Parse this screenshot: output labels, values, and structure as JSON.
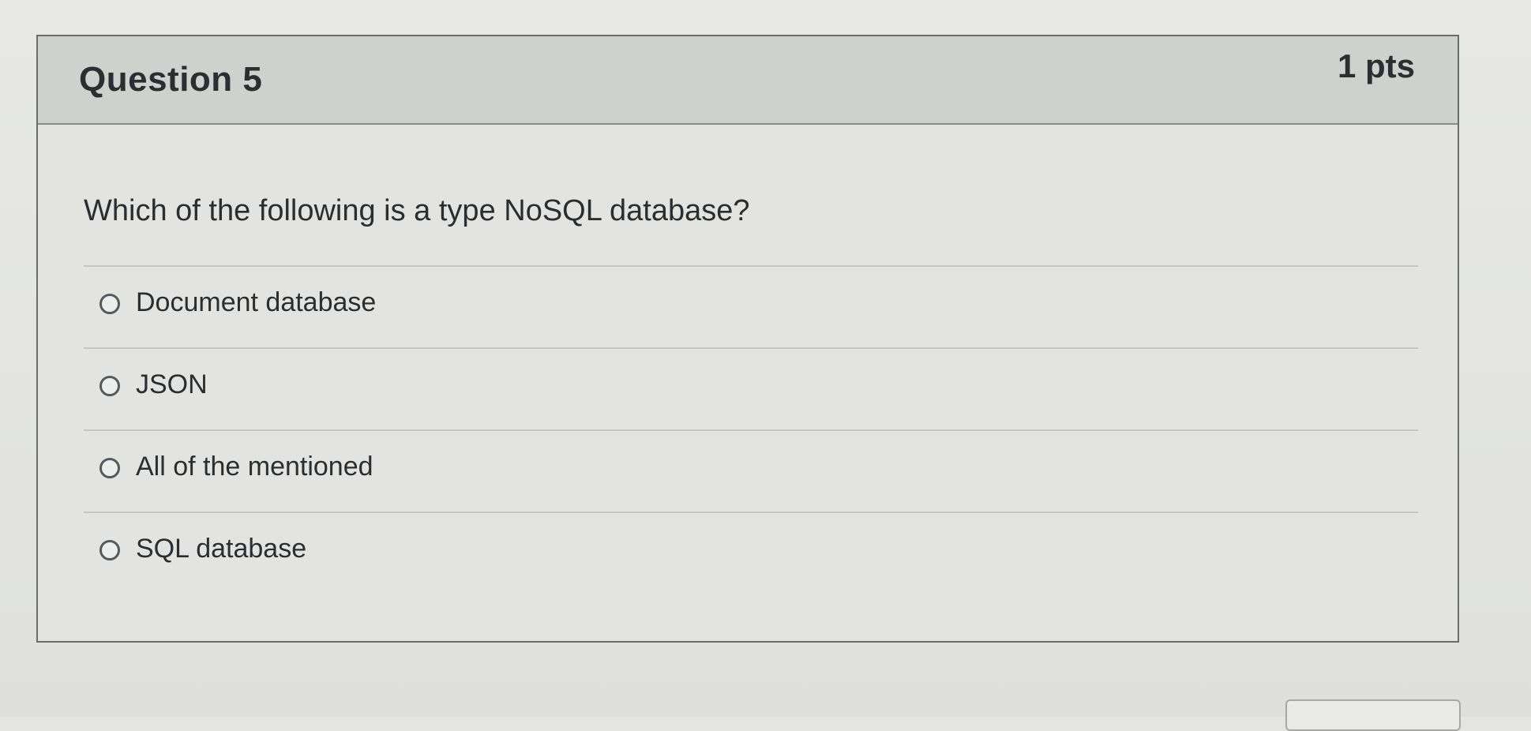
{
  "question": {
    "title": "Question 5",
    "points": "1 pts",
    "text": "Which of the following is a type NoSQL database?"
  },
  "answers": [
    {
      "label": "Document database"
    },
    {
      "label": "JSON"
    },
    {
      "label": "All of the mentioned"
    },
    {
      "label": "SQL database"
    }
  ]
}
